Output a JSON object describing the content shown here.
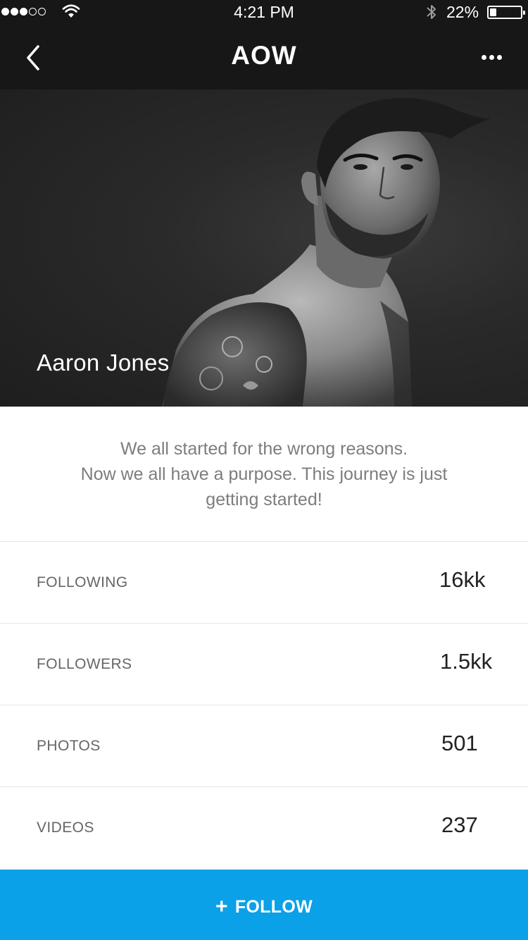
{
  "status_bar": {
    "time": "4:21 PM",
    "battery_text": "22%",
    "battery_level": 0.22,
    "signal_bars_filled": 3,
    "signal_bars_total": 5,
    "icons": [
      "signal-dots-icon",
      "wifi-icon",
      "bluetooth-icon",
      "battery-icon"
    ]
  },
  "nav": {
    "title": "AOW",
    "back_icon": "chevron-left-icon",
    "more_icon": "more-horizontal-icon"
  },
  "profile": {
    "name": "Aaron Jones"
  },
  "bio": {
    "lines": [
      "We all started for the wrong reasons.",
      "Now we all have a purpose. This journey is just",
      "getting started!"
    ]
  },
  "stats": [
    {
      "label": "FOLLOWING",
      "value": "16kk"
    },
    {
      "label": "FOLLOWERS",
      "value": "1.5kk"
    },
    {
      "label": "PHOTOS",
      "value": "501"
    },
    {
      "label": "VIDEOS",
      "value": "237"
    }
  ],
  "follow_button": {
    "icon_text": "+",
    "label": "FOLLOW"
  },
  "colors": {
    "bar_background": "#171717",
    "accent": "#0aa1e8",
    "label_gray": "#666666",
    "bio_gray": "#7d7d7d"
  }
}
